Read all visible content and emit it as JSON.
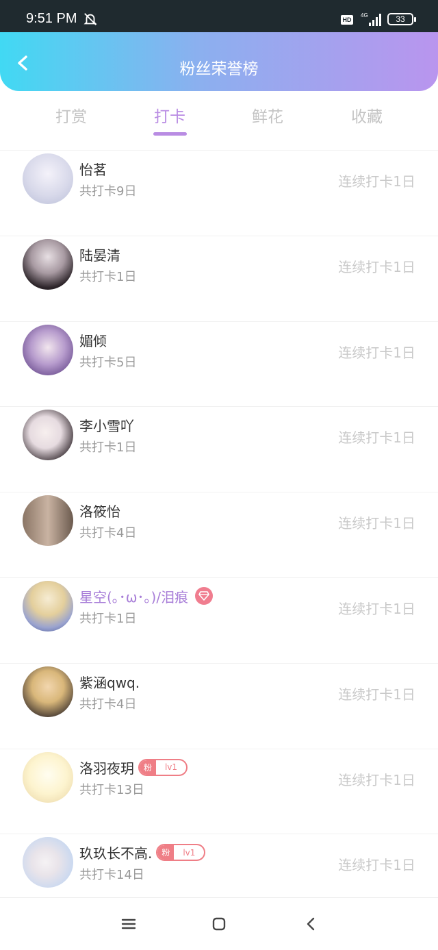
{
  "status_bar": {
    "time": "9:51 PM",
    "icons": [
      "bell-off-icon",
      "hd-icon",
      "signal-4g-icon",
      "battery-icon"
    ],
    "hd_label": "HD",
    "battery": "33"
  },
  "header": {
    "title": "粉丝荣誉榜",
    "back_icon": "chevron-left-icon",
    "gradient": [
      "#41d9f3",
      "#b995ee"
    ]
  },
  "tabs": [
    {
      "label": "打赏",
      "active": false
    },
    {
      "label": "打卡",
      "active": true
    },
    {
      "label": "鲜花",
      "active": false
    },
    {
      "label": "收藏",
      "active": false
    }
  ],
  "colors": {
    "accent": "#b98ce3",
    "badge": "#ef7e86",
    "muted_text": "#c9c9c9"
  },
  "fans": [
    {
      "name": "怡茗",
      "total": "共打卡9日",
      "streak": "连续打卡1日",
      "avatar_colors": [
        "#e8e6f2",
        "#b9bed8"
      ]
    },
    {
      "name": "陆晏清",
      "total": "共打卡1日",
      "streak": "连续打卡1日",
      "avatar_colors": [
        "#d9d4d8",
        "#2b2328"
      ]
    },
    {
      "name": "媚倾",
      "total": "共打卡5日",
      "streak": "连续打卡1日",
      "avatar_colors": [
        "#c9b8da",
        "#6a4c8e"
      ]
    },
    {
      "name": "李小雪吖",
      "total": "共打卡1日",
      "streak": "连续打卡1日",
      "avatar_colors": [
        "#f1eef0",
        "#3a3035"
      ]
    },
    {
      "name": "洛筱怡",
      "total": "共打卡4日",
      "streak": "连续打卡1日",
      "avatar_colors": [
        "#c9b3a2",
        "#6b5a4e"
      ]
    },
    {
      "name": "星空(｡･ω･｡)/泪痕",
      "total": "共打卡1日",
      "streak": "连续打卡1日",
      "vip": true,
      "badge": "diamond-icon",
      "avatar_colors": [
        "#efe3c6",
        "#3c4c8e"
      ]
    },
    {
      "name": "紫涵qwq.",
      "total": "共打卡4日",
      "streak": "连续打卡1日",
      "avatar_colors": [
        "#d9b77a",
        "#2c2c3a"
      ]
    },
    {
      "name": "洛羽夜玥",
      "total": "共打卡13日",
      "streak": "连续打卡1日",
      "fan_badge": {
        "label": "粉",
        "level": "lv1"
      },
      "avatar_colors": [
        "#fdf4cf",
        "#e8d3a2"
      ]
    },
    {
      "name": "玖玖长不高.",
      "total": "共打卡14日",
      "streak": "连续打卡1日",
      "fan_badge": {
        "label": "粉",
        "level": "lv1"
      },
      "avatar_colors": [
        "#c9d8f0",
        "#e9e4ea"
      ]
    }
  ],
  "bottom_nav": [
    "menu-icon",
    "home-square-icon",
    "back-triangle-icon"
  ]
}
